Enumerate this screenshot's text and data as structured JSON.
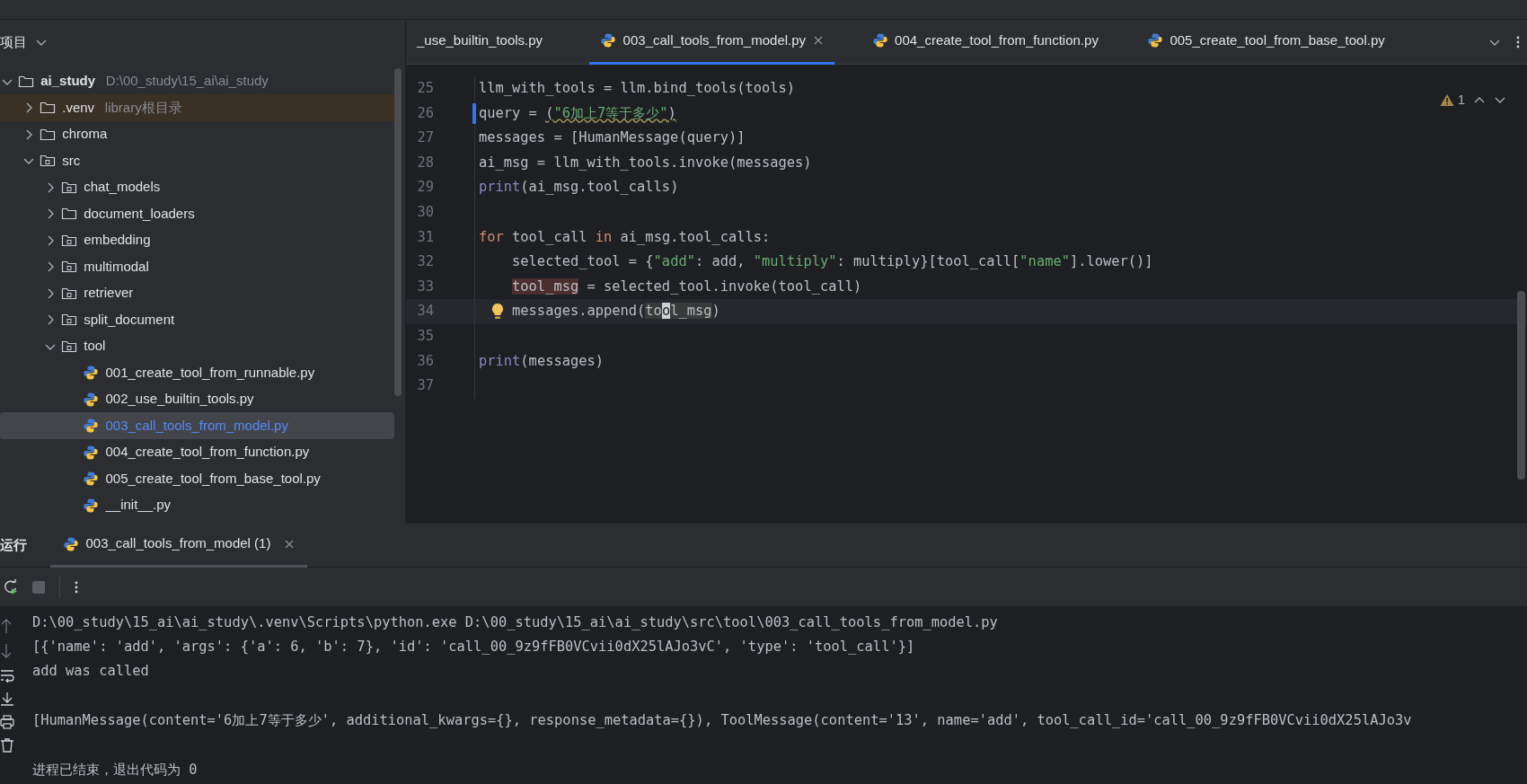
{
  "sidebar": {
    "title": "项目",
    "tree": [
      {
        "label": "ai_study",
        "hint": "D:\\00_study\\15_ai\\ai_study",
        "kind": "project",
        "expanded": true,
        "selected": false,
        "children": [
          {
            "label": ".venv",
            "hint": "library根目录",
            "kind": "library",
            "expanded": false,
            "selected": false
          },
          {
            "label": "chroma",
            "kind": "folder",
            "expanded": false,
            "selected": false
          },
          {
            "label": "src",
            "kind": "source",
            "expanded": true,
            "selected": false,
            "children": [
              {
                "label": "chat_models",
                "kind": "source",
                "expanded": false,
                "selected": false
              },
              {
                "label": "document_loaders",
                "kind": "folder",
                "expanded": false,
                "selected": false
              },
              {
                "label": "embedding",
                "kind": "source",
                "expanded": false,
                "selected": false
              },
              {
                "label": "multimodal",
                "kind": "source",
                "expanded": false,
                "selected": false
              },
              {
                "label": "retriever",
                "kind": "source",
                "expanded": false,
                "selected": false
              },
              {
                "label": "split_document",
                "kind": "source",
                "expanded": false,
                "selected": false
              },
              {
                "label": "tool",
                "kind": "source",
                "expanded": true,
                "selected": false,
                "children": [
                  {
                    "label": "001_create_tool_from_runnable.py",
                    "kind": "python",
                    "selected": false
                  },
                  {
                    "label": "002_use_builtin_tools.py",
                    "kind": "python",
                    "selected": false
                  },
                  {
                    "label": "003_call_tools_from_model.py",
                    "kind": "python",
                    "selected": true
                  },
                  {
                    "label": "004_create_tool_from_function.py",
                    "kind": "python",
                    "selected": false
                  },
                  {
                    "label": "005_create_tool_from_base_tool.py",
                    "kind": "python",
                    "selected": false
                  },
                  {
                    "label": "__init__.py",
                    "kind": "python",
                    "selected": false
                  }
                ]
              }
            ]
          }
        ]
      }
    ]
  },
  "editor_tabs": [
    {
      "label": "_use_builtin_tools.py",
      "kind": "plain",
      "selected": false,
      "closable": false
    },
    {
      "label": "003_call_tools_from_model.py",
      "kind": "python",
      "selected": true,
      "closable": true
    },
    {
      "label": "004_create_tool_from_function.py",
      "kind": "python",
      "selected": false,
      "closable": false
    },
    {
      "label": "005_create_tool_from_base_tool.py",
      "kind": "python",
      "selected": false,
      "closable": false
    }
  ],
  "editor": {
    "warning_count": "1",
    "lines": [
      {
        "number": "25",
        "current": false,
        "modified": false,
        "intention": false,
        "tokens": [
          {
            "text": "llm_with_tools = llm.bind_tools(tools)",
            "kind": "plain"
          }
        ]
      },
      {
        "number": "26",
        "current": false,
        "modified": true,
        "intention": false,
        "tokens": [
          {
            "text": "query = ",
            "kind": "plain"
          },
          {
            "text": "(",
            "kind": "typo"
          },
          {
            "text": "\"6加上7等于多少\"",
            "kind": "typo_string"
          },
          {
            "text": ")",
            "kind": "typo"
          }
        ]
      },
      {
        "number": "27",
        "current": false,
        "modified": false,
        "intention": false,
        "tokens": [
          {
            "text": "messages = [HumanMessage(query)]",
            "kind": "plain"
          }
        ]
      },
      {
        "number": "28",
        "current": false,
        "modified": false,
        "intention": false,
        "tokens": [
          {
            "text": "ai_msg = llm_with_tools.invoke(messages)",
            "kind": "plain"
          }
        ]
      },
      {
        "number": "29",
        "current": false,
        "modified": false,
        "intention": false,
        "tokens": [
          {
            "text": "print",
            "kind": "builtin"
          },
          {
            "text": "(ai_msg.tool_calls)",
            "kind": "plain"
          }
        ]
      },
      {
        "number": "30",
        "current": false,
        "modified": false,
        "intention": false
      },
      {
        "number": "31",
        "current": false,
        "modified": false,
        "intention": false,
        "tokens": [
          {
            "text": "for",
            "kind": "keyword"
          },
          {
            "text": " tool_call ",
            "kind": "plain"
          },
          {
            "text": "in",
            "kind": "keyword"
          },
          {
            "text": " ai_msg.tool_calls:",
            "kind": "plain"
          }
        ]
      },
      {
        "number": "32",
        "current": false,
        "modified": false,
        "intention": false,
        "indented": true,
        "tokens": [
          {
            "text": "selected_tool = {",
            "kind": "plain"
          },
          {
            "text": "\"add\"",
            "kind": "string"
          },
          {
            "text": ": add, ",
            "kind": "plain"
          },
          {
            "text": "\"multiply\"",
            "kind": "string"
          },
          {
            "text": ": multiply}[tool_call[",
            "kind": "plain"
          },
          {
            "text": "\"name\"",
            "kind": "string"
          },
          {
            "text": "].lower()]",
            "kind": "plain"
          }
        ]
      },
      {
        "number": "33",
        "current": false,
        "modified": false,
        "intention": false,
        "indented": true,
        "tokens": [
          {
            "text": "tool_msg",
            "kind": "write_usage"
          },
          {
            "text": " = selected_tool.invoke(tool_call)",
            "kind": "plain"
          }
        ]
      },
      {
        "number": "34",
        "current": true,
        "modified": false,
        "intention": true,
        "indented": true,
        "tokens": [
          {
            "text": "messages.append(",
            "kind": "plain"
          },
          {
            "text": "to",
            "kind": "read_usage"
          },
          {
            "text": "o",
            "kind": "caret"
          },
          {
            "text": "l_msg",
            "kind": "read_usage"
          },
          {
            "text": ")",
            "kind": "plain"
          }
        ]
      },
      {
        "number": "35",
        "current": false,
        "modified": false,
        "intention": false
      },
      {
        "number": "36",
        "current": false,
        "modified": false,
        "intention": false,
        "tokens": [
          {
            "text": "print",
            "kind": "builtin"
          },
          {
            "text": "(messages)",
            "kind": "plain"
          }
        ]
      },
      {
        "number": "37",
        "current": false,
        "modified": false,
        "intention": false
      }
    ]
  },
  "run_panel": {
    "title": "运行",
    "tabs": [
      {
        "label": "003_call_tools_from_model (1)",
        "selected": true
      }
    ],
    "output": [
      {
        "kind": "text",
        "text": "D:\\00_study\\15_ai\\ai_study\\.venv\\Scripts\\python.exe D:\\00_study\\15_ai\\ai_study\\src\\tool\\003_call_tools_from_model.py"
      },
      {
        "kind": "text",
        "text": "[{'name': 'add', 'args': {'a': 6, 'b': 7}, 'id': 'call_00_9z9fFB0VCvii0dX25lAJo3vC', 'type': 'tool_call'}]"
      },
      {
        "kind": "text",
        "text": "add was called"
      },
      {
        "kind": "blank"
      },
      {
        "kind": "text",
        "text": "[HumanMessage(content='6加上7等于多少', additional_kwargs={}, response_metadata={}), ToolMessage(content='13', name='add', tool_call_id='call_00_9z9fFB0VCvii0dX25lAJo3v"
      },
      {
        "kind": "blank"
      },
      {
        "kind": "text",
        "text": "进程已结束，退出代码为 0"
      }
    ]
  }
}
